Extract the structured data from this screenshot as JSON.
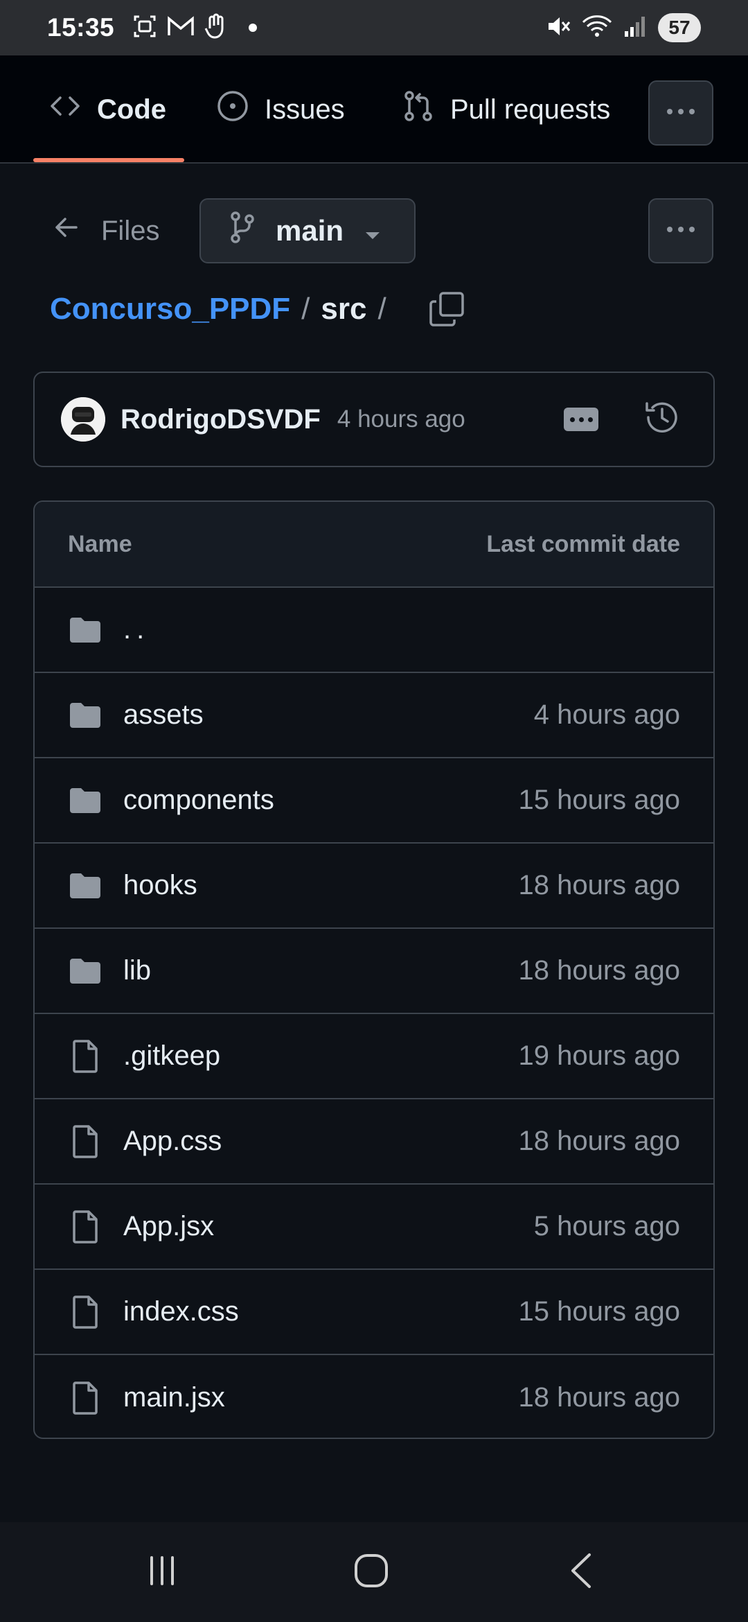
{
  "status_bar": {
    "time": "15:35",
    "battery": "57",
    "icons": [
      "screenshot-icon",
      "gmail-icon",
      "gesture-icon",
      "dot-icon",
      "mute-icon",
      "wifi-icon",
      "signal-icon"
    ]
  },
  "tabs": [
    {
      "label": "Code",
      "icon": "code-icon",
      "active": true
    },
    {
      "label": "Issues",
      "icon": "issue-circle-icon",
      "active": false
    },
    {
      "label": "Pull requests",
      "icon": "pull-request-icon",
      "active": false
    }
  ],
  "toolbar": {
    "files_label": "Files",
    "branch": "main"
  },
  "breadcrumb": {
    "repo": "Concurso_PPDF",
    "separator": "/",
    "dir": "src",
    "trailing": "/"
  },
  "commit": {
    "author": "RodrigoDSVDF",
    "time": "4 hours ago"
  },
  "table": {
    "col_name": "Name",
    "col_date": "Last commit date",
    "rows": [
      {
        "type": "folder",
        "name": "..",
        "date": ""
      },
      {
        "type": "folder",
        "name": "assets",
        "date": "4 hours ago"
      },
      {
        "type": "folder",
        "name": "components",
        "date": "15 hours ago"
      },
      {
        "type": "folder",
        "name": "hooks",
        "date": "18 hours ago"
      },
      {
        "type": "folder",
        "name": "lib",
        "date": "18 hours ago"
      },
      {
        "type": "file",
        "name": ".gitkeep",
        "date": "19 hours ago"
      },
      {
        "type": "file",
        "name": "App.css",
        "date": "18 hours ago"
      },
      {
        "type": "file",
        "name": "App.jsx",
        "date": "5 hours ago"
      },
      {
        "type": "file",
        "name": "index.css",
        "date": "15 hours ago"
      },
      {
        "type": "file",
        "name": "main.jsx",
        "date": "18 hours ago"
      }
    ]
  },
  "colors": {
    "background": "#0d1117",
    "link": "#4493f8",
    "tab_underline": "#f78166",
    "muted": "#9198a1",
    "border": "#3d444d"
  }
}
